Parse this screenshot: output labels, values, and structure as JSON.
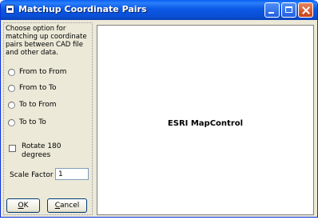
{
  "window": {
    "title": "Matchup Coordinate Pairs"
  },
  "instructions": "Choose option for matching up coordinate pairs between CAD file and other data.",
  "options": [
    {
      "label": "From to From"
    },
    {
      "label": "From to To"
    },
    {
      "label": "To to From"
    },
    {
      "label": "To to To"
    }
  ],
  "rotate": {
    "label": "Rotate 180 degrees",
    "checked": false
  },
  "scale": {
    "label": "Scale Factor",
    "value": "1"
  },
  "buttons": {
    "ok": {
      "hotkey": "O",
      "rest": "K"
    },
    "cancel": {
      "hotkey": "C",
      "rest": "ancel"
    }
  },
  "map": {
    "label": "ESRI MapControl"
  },
  "colors": {
    "titlebar": "#0a4fd6",
    "face": "#ece9d8",
    "map_background": "#ffffff"
  }
}
